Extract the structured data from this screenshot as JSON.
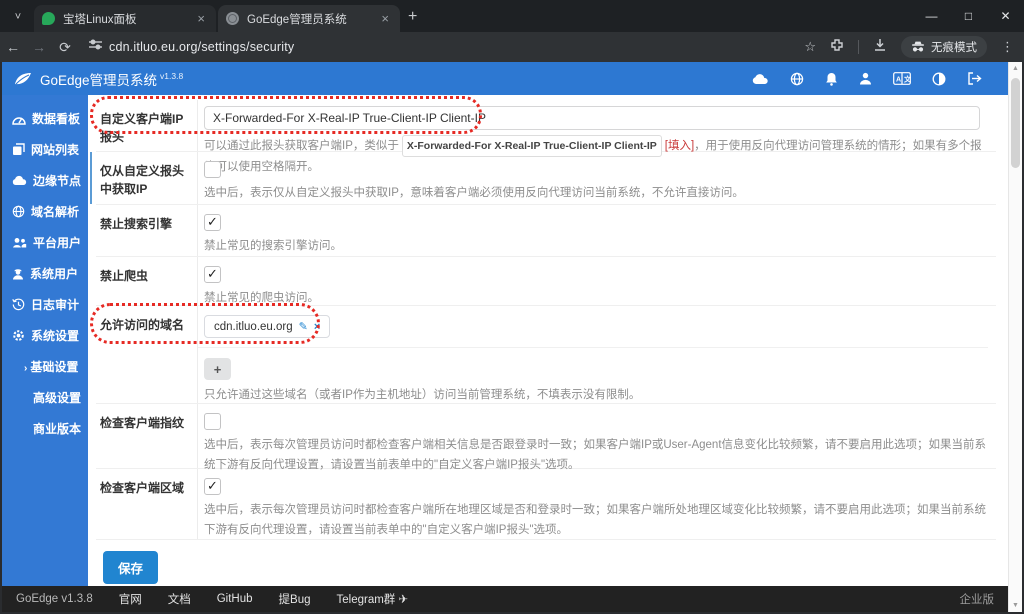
{
  "browser": {
    "tabs": [
      {
        "title": "宝塔Linux面板"
      },
      {
        "title": "GoEdge管理员系统"
      }
    ],
    "new_tab": "+",
    "url": "cdn.itluo.eu.org/settings/security",
    "incognito_label": "无痕模式",
    "window_controls": {
      "minimize": "—",
      "maximize": "□",
      "close": "✕"
    },
    "nav": {
      "back": "←",
      "forward": "→",
      "reload": "⟳",
      "kebab": "⋮",
      "star": "☆",
      "tabsearch": "˅"
    }
  },
  "app": {
    "title": "GoEdge管理员系统",
    "version": "v1.3.8"
  },
  "sidebar": {
    "items": [
      {
        "label": "数据看板"
      },
      {
        "label": "网站列表"
      },
      {
        "label": "边缘节点"
      },
      {
        "label": "域名解析"
      },
      {
        "label": "平台用户"
      },
      {
        "label": "系统用户"
      },
      {
        "label": "日志审计"
      },
      {
        "label": "系统设置"
      }
    ],
    "subitems": [
      {
        "label": "基础设置",
        "active": true,
        "chevron": "›"
      },
      {
        "label": "高级设置"
      },
      {
        "label": "商业版本"
      }
    ]
  },
  "form": {
    "rows": [
      {
        "label": "自定义客户端IP报头",
        "value": "X-Forwarded-For X-Real-IP True-Client-IP Client-IP",
        "help_pre": "可以通过此报头获取客户端IP，类似于",
        "help_code": "X-Forwarded-For X-Real-IP True-Client-IP Client-IP",
        "help_link": "[填入]",
        "help_post": "，用于使用反向代理访问管理系统的情形；如果有多个报头可以使用空格隔开。"
      },
      {
        "label": "仅从自定义报头中获取IP",
        "checked": false,
        "help": "选中后，表示仅从自定义报头中获取IP，意味着客户端必须使用反向代理访问当前系统，不允许直接访问。"
      },
      {
        "label": "禁止搜索引擎",
        "checked": true,
        "help": "禁止常见的搜索引擎访问。"
      },
      {
        "label": "禁止爬虫",
        "checked": true,
        "help": "禁止常见的爬虫访问。"
      },
      {
        "label": "允许访问的域名",
        "tag": "cdn.itluo.eu.org",
        "tag_edit": "✎",
        "tag_delete": "×",
        "add_button": "+",
        "help": "只允许通过这些域名（或者IP作为主机地址）访问当前管理系统，不填表示没有限制。"
      },
      {
        "label": "检查客户端指纹",
        "checked": false,
        "help": "选中后，表示每次管理员访问时都检查客户端相关信息是否跟登录时一致；如果客户端IP或User-Agent信息变化比较频繁，请不要启用此选项；如果当前系统下游有反向代理设置，请设置当前表单中的\"自定义客户端IP报头\"选项。"
      },
      {
        "label": "检查客户端区域",
        "checked": true,
        "help": "选中后，表示每次管理员访问时都检查客户端所在地理区域是否和登录时一致；如果客户端所处地理区域变化比较频繁，请不要启用此选项；如果当前系统下游有反向代理设置，请设置当前表单中的\"自定义客户端IP报头\"选项。"
      }
    ],
    "save_label": "保存"
  },
  "footer": {
    "version": "GoEdge v1.3.8",
    "links": [
      "官网",
      "文档",
      "GitHub",
      "提Bug",
      "Telegram群"
    ],
    "telegram_icon": "✈",
    "right": "企业版"
  },
  "colors": {
    "accent_blue": "#2d78d2",
    "sidebar_blue": "#3379d4",
    "save_blue": "#2185d0",
    "annotation_red": "#e62a24"
  }
}
